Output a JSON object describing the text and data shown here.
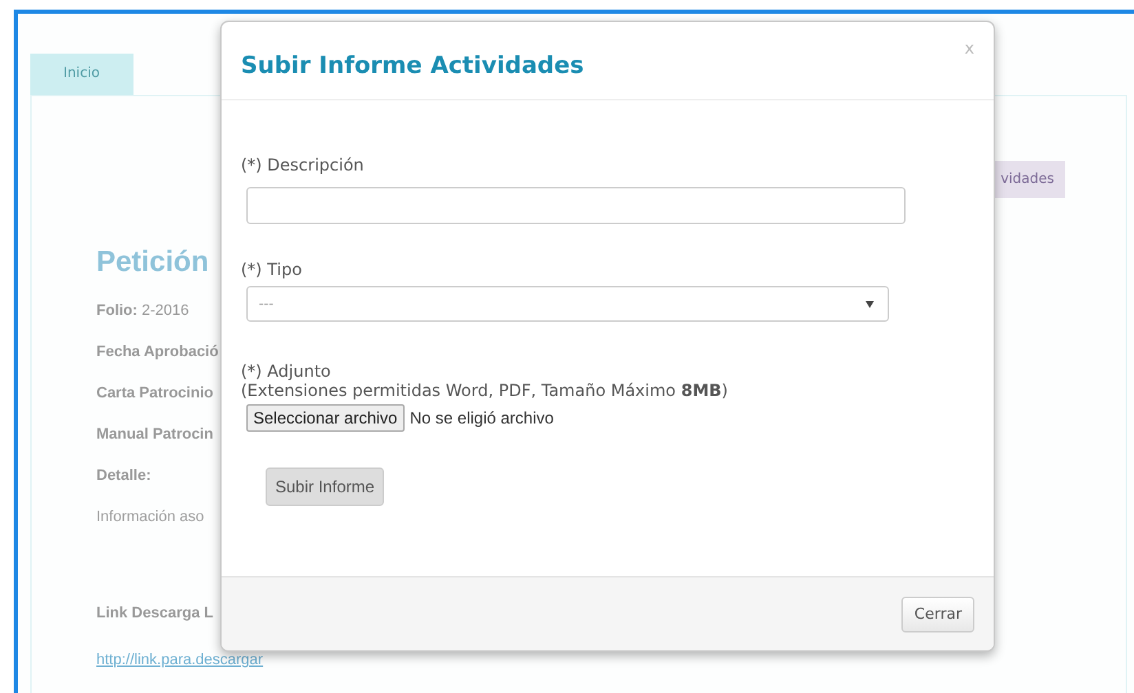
{
  "page": {
    "tabs": [
      {
        "label": "Inicio",
        "selected": true
      }
    ],
    "action_button": "vidades",
    "title": "Petición",
    "fields": [
      {
        "label": "Folio:",
        "value": "2-2016"
      },
      {
        "label": "Fecha Aprobació"
      },
      {
        "label": "Carta Patrocinio"
      },
      {
        "label": "Manual Patrocin"
      },
      {
        "label": "Detalle:"
      }
    ],
    "detail_text": "Información aso",
    "link_label": "Link Descarga L",
    "link": "http://link.para.descargar"
  },
  "dialog": {
    "title": "Subir Informe Actividades",
    "close": "x",
    "fields": [
      {
        "kind": "text",
        "label": "(*) Descripción"
      },
      {
        "kind": "select",
        "label": "(*) Tipo",
        "value": "---"
      },
      {
        "kind": "file",
        "label": "(*) Adjunto",
        "hint": "(Extensiones permitidas Word, PDF, Tamaño Máximo **8MB**)",
        "button": "Seleccionar archivo",
        "status": "No se eligió archivo"
      }
    ],
    "submit": "Subir Informe",
    "footer_button": "Cerrar"
  }
}
